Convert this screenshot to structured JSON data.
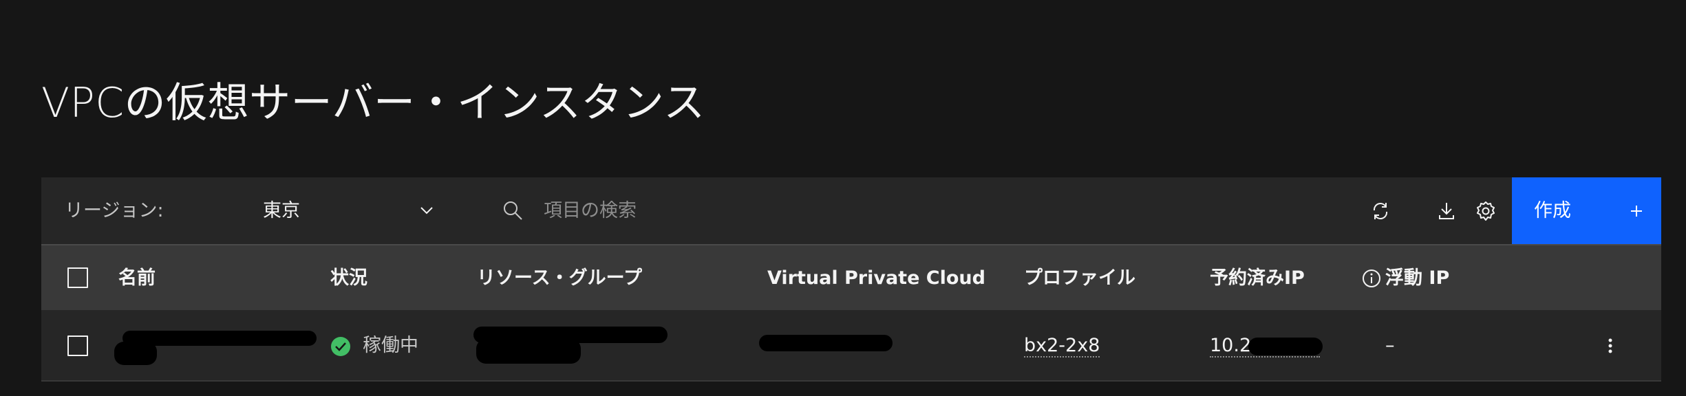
{
  "page": {
    "title": "VPCの仮想サーバー・インスタンス"
  },
  "toolbar": {
    "region_label": "リージョン:",
    "region_value": "東京",
    "search_placeholder": "項目の検索",
    "create_label": "作成",
    "icons": [
      "refresh-icon",
      "download-icon",
      "settings-icon",
      "plus-icon"
    ]
  },
  "table": {
    "headers": {
      "name": "名前",
      "status": "状況",
      "resource_group": "リソース・グループ",
      "vpc": "Virtual Private Cloud",
      "profile": "プロファイル",
      "reserved_ip": "予約済みIP",
      "floating_ip": "浮動 IP"
    },
    "rows": [
      {
        "name": "",
        "status": "稼働中",
        "status_color": "#42be65",
        "resource_group": "",
        "vpc": "",
        "profile": "bx2-2x8",
        "reserved_ip": "10.2",
        "floating_ip": "–"
      }
    ]
  },
  "colors": {
    "background": "#161616",
    "toolbar": "#262626",
    "header": "#393939",
    "accent": "#0f62fe"
  }
}
